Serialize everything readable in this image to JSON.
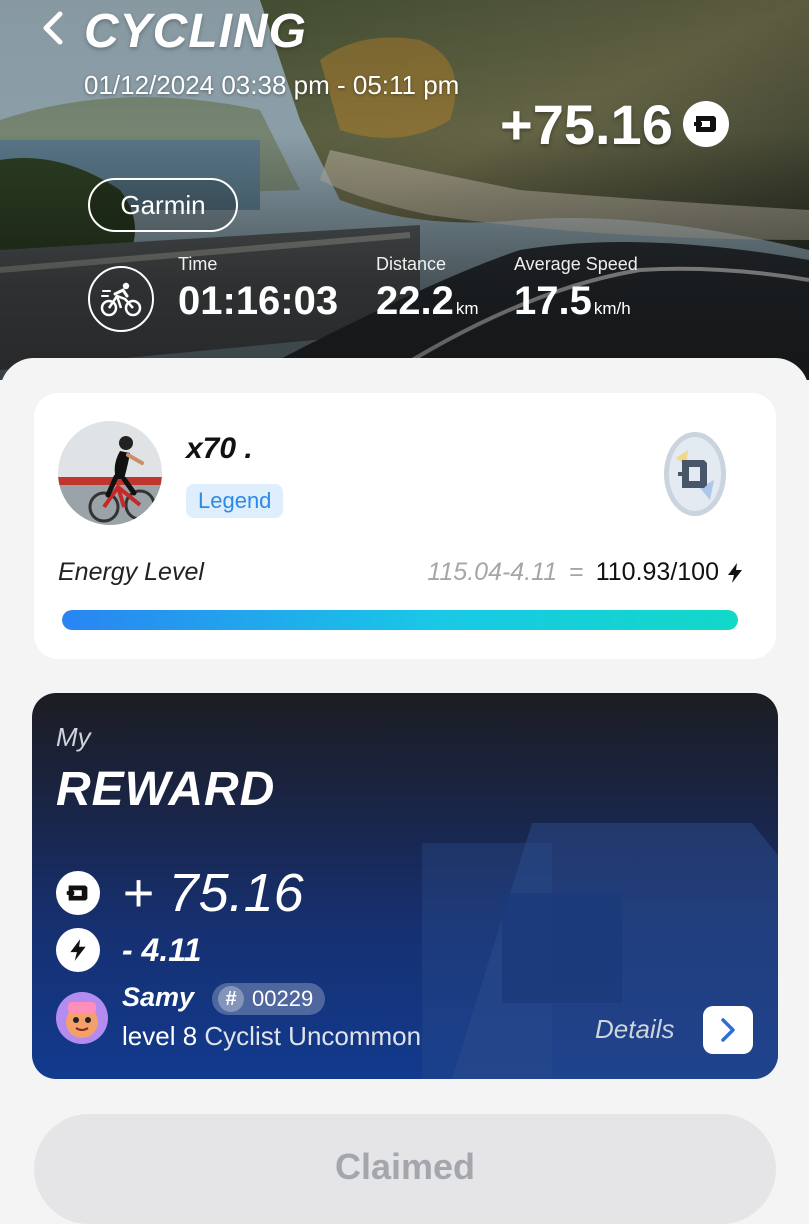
{
  "header": {
    "title": "CYCLING",
    "datetime": "01/12/2024 03:38 pm - 05:11 pm",
    "earned": "+75.16",
    "source": "Garmin"
  },
  "stats": [
    {
      "label": "Time",
      "value": "01:16:03",
      "unit": ""
    },
    {
      "label": "Distance",
      "value": "22.2",
      "unit": "km"
    },
    {
      "label": "Average Speed",
      "value": "17.5",
      "unit": "km/h"
    }
  ],
  "profile": {
    "username": "x70 .",
    "rank": "Legend"
  },
  "energy": {
    "label": "Energy Level",
    "calc": "115.04-4.11",
    "equals": "=",
    "result": "110.93/100",
    "level_fraction": 1.0
  },
  "reward": {
    "my": "My",
    "title": "REWARD",
    "gain": "+ 75.16",
    "energy_cost": "- 4.11",
    "nft_name": "Samy",
    "nft_hash": "#",
    "nft_id": "00229",
    "nft_level_key": "level 8",
    "nft_level_value": "Cyclist Uncommon",
    "details": "Details"
  },
  "claim": {
    "label": "Claimed"
  },
  "colors": {
    "accent_blue": "#2d8ae6",
    "energy_gradient_start": "#2a84f2",
    "energy_gradient_end": "#12d8c8",
    "reward_bg": "#163070"
  }
}
